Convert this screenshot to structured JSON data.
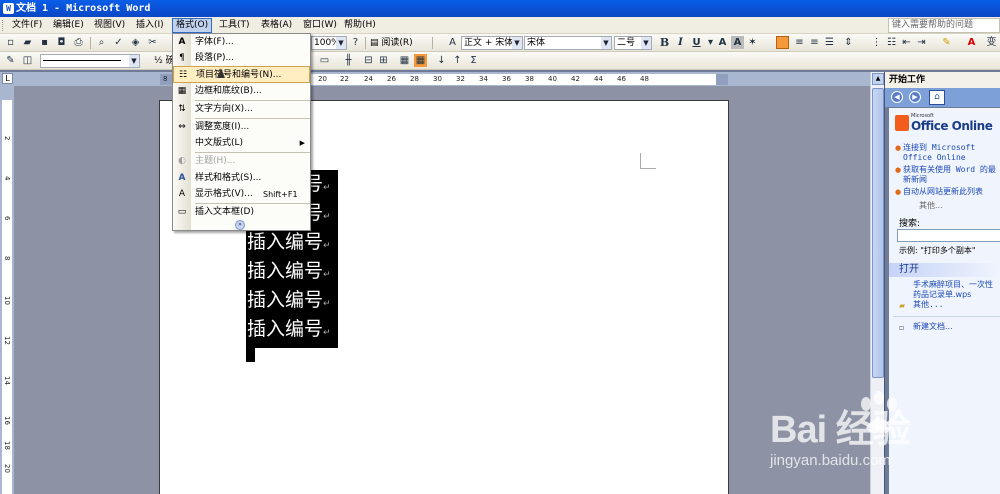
{
  "window": {
    "title": "文档 1 - Microsoft Word"
  },
  "menu": {
    "items": [
      "文件(F)",
      "编辑(E)",
      "视图(V)",
      "插入(I)",
      "格式(O)",
      "工具(T)",
      "表格(A)",
      "窗口(W)",
      "帮助(H)"
    ],
    "help_placeholder": "键入需要帮助的问题"
  },
  "toolbar": {
    "zoom": "100%",
    "read_label": "阅读(R)",
    "style_combo": "正文 + 宋体",
    "font_combo": "宋体",
    "size_combo": "二号",
    "bold": "B",
    "italic": "I",
    "underline": "U",
    "border_style": "½ 磅"
  },
  "ruler": {
    "ticks": [
      "8",
      "20",
      "22",
      "24",
      "26",
      "28",
      "30",
      "32",
      "34",
      "36",
      "38",
      "40",
      "42",
      "44",
      "46",
      "48"
    ]
  },
  "vruler": {
    "ticks": [
      "2",
      "4",
      "6",
      "8",
      "10",
      "12",
      "14",
      "16",
      "18",
      "20"
    ]
  },
  "format_menu": {
    "items": [
      {
        "label": "字体(F)...",
        "icon": "font-icon"
      },
      {
        "label": "段落(P)...",
        "icon": "paragraph-icon"
      },
      {
        "label": "项目符号和编号(N)...",
        "icon": "bullets-icon"
      },
      {
        "label": "边框和底纹(B)...",
        "icon": "borders-icon"
      },
      {
        "label": "文字方向(X)...",
        "icon": "text-direction-icon"
      },
      {
        "label": "调整宽度(I)...",
        "icon": "width-icon"
      },
      {
        "label": "中文版式(L)",
        "icon": "chinese-layout-icon"
      },
      {
        "label": "主题(H)...",
        "icon": "theme-icon"
      },
      {
        "label": "样式和格式(S)...",
        "icon": "styles-icon"
      },
      {
        "label": "显示格式(V)...",
        "shortcut": "Shift+F1",
        "icon": "reveal-formatting-icon"
      },
      {
        "label": "插入文本框(D)",
        "icon": "textbox-icon"
      }
    ]
  },
  "document": {
    "lines": [
      "插入编号",
      "插入编号",
      "插入编号",
      "插入编号",
      "插入编号",
      "插入编号"
    ]
  },
  "task_pane": {
    "title": "开始工作",
    "logo_small": "Microsoft",
    "logo_big": "Office Online",
    "links": [
      "连接到 Microsoft Office Online",
      "获取有关使用 Word 的最新新闻",
      "自动从网站更新此列表"
    ],
    "more": "其他...",
    "search_label": "搜索:",
    "example": "示例: \"打印多个副本\"",
    "open_heading": "打开",
    "recent_file": "手术麻醉项目、一次性药品记录单.wps",
    "open_more": "其他...",
    "new_doc": "新建文档..."
  },
  "watermark": {
    "brand": "Bai  经验",
    "url": "jingyan.baidu.com"
  }
}
